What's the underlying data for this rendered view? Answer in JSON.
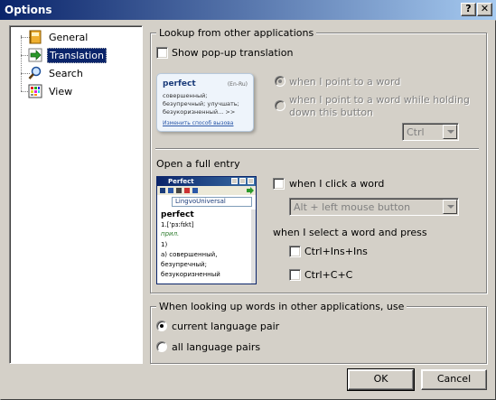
{
  "window": {
    "title": "Options",
    "help_label": "?",
    "close_label": "✕"
  },
  "tree": {
    "items": [
      {
        "label": "General",
        "icon": "notebook-icon"
      },
      {
        "label": "Translation",
        "icon": "green-arrow-icon",
        "selected": true
      },
      {
        "label": "Search",
        "icon": "magnifier-icon"
      },
      {
        "label": "View",
        "icon": "grid-icon"
      }
    ]
  },
  "lookup": {
    "legend": "Lookup from other applications",
    "show_popup": {
      "label": "Show pop-up translation",
      "checked": false
    },
    "radio_point": {
      "label": "when I point to a word",
      "checked": true,
      "enabled": false
    },
    "radio_hold": {
      "label": "when I point to a word while holding down this button",
      "checked": false,
      "enabled": false
    },
    "hold_key": {
      "value": "Ctrl",
      "enabled": false
    },
    "tooltip_preview": {
      "word": "perfect",
      "lang": "(En-Ru)",
      "lines": [
        "совершенный;",
        "безупречный; улучшать;",
        "безукоризненный... >>"
      ],
      "link": "Изменить способ вызова"
    }
  },
  "full_entry": {
    "legend": "Open a full entry",
    "click_word": {
      "label": "when I click a word",
      "checked": false
    },
    "mouse_button": {
      "value": "Alt + left mouse button",
      "enabled": false
    },
    "select_heading": "when I select a word and press",
    "ctrl_ins": {
      "label": "Ctrl+Ins+Ins",
      "checked": false
    },
    "ctrl_c": {
      "label": "Ctrl+C+C",
      "checked": false
    },
    "preview": {
      "title": "Perfect",
      "dictionary": "LingvoUniversal",
      "headword": "perfect",
      "transcription": "1.['pɜːfɪkt]",
      "pos": "прил.",
      "sense": "1)",
      "lines": [
        "а) совершенный,",
        "безупречный;",
        "безукоризненный"
      ]
    }
  },
  "lookup_scope": {
    "legend": "When looking up words in other applications, use",
    "options": [
      {
        "label": "current language pair",
        "checked": true
      },
      {
        "label": "all language pairs",
        "checked": false
      }
    ]
  },
  "buttons": {
    "ok": "OK",
    "cancel": "Cancel"
  }
}
